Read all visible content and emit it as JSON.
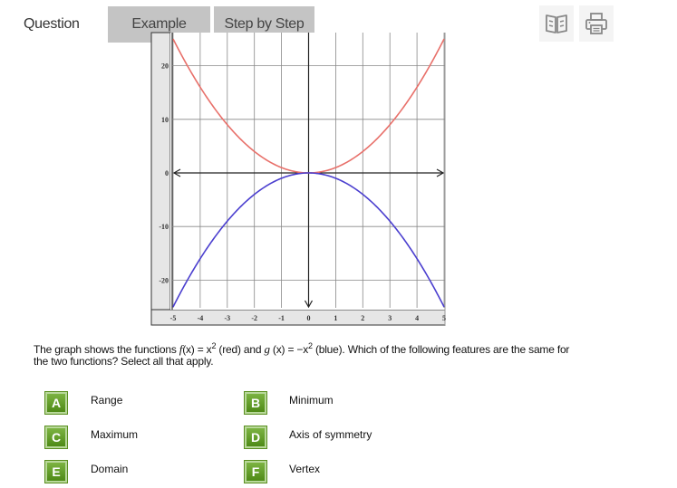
{
  "header": {
    "question_label": "Question",
    "example_label": "Example",
    "step_by_step_label": "Step by Step",
    "icons": [
      "book-icon",
      "print-icon"
    ]
  },
  "chart_data": {
    "type": "line",
    "title": "",
    "xlabel": "",
    "ylabel": "",
    "xlim": [
      -5,
      5
    ],
    "ylim": [
      -25,
      25
    ],
    "x_ticks": [
      -5,
      -4,
      -3,
      -2,
      -1,
      0,
      1,
      2,
      3,
      4,
      5
    ],
    "y_ticks": [
      20,
      10,
      0,
      -10,
      -20
    ],
    "y_tick_labels": [
      "20",
      "10",
      "0",
      "-10",
      "-20"
    ],
    "x_tick_labels": [
      "-5",
      "-4",
      "-3",
      "-2",
      "-1",
      "0",
      "1",
      "2",
      "3",
      "4",
      "5"
    ],
    "grid": true,
    "series": [
      {
        "name": "f(x) = x^2",
        "color": "#e8706a",
        "expression": "x^2",
        "x": [
          -5,
          -4,
          -3,
          -2,
          -1,
          0,
          1,
          2,
          3,
          4,
          5
        ],
        "y": [
          25,
          16,
          9,
          4,
          1,
          0,
          1,
          4,
          9,
          16,
          25
        ]
      },
      {
        "name": "g(x) = -x^2",
        "color": "#4b3fcf",
        "expression": "-x^2",
        "x": [
          -5,
          -4,
          -3,
          -2,
          -1,
          0,
          1,
          2,
          3,
          4,
          5
        ],
        "y": [
          -25,
          -16,
          -9,
          -4,
          -1,
          0,
          -1,
          -4,
          -9,
          -16,
          -25
        ]
      }
    ]
  },
  "question": {
    "prefix": "The graph shows the functions ",
    "f_lhs": "f",
    "f_arg": "(x)",
    "f_eq": " = x",
    "f_exp": "2",
    "mid": " (red) and ",
    "g_lhs": "g",
    "g_arg": " (x)",
    "g_eq": " = −x",
    "g_exp": "2",
    "suffix": " (blue). Which of the following features are the same for the two functions? Select all that apply."
  },
  "options": [
    {
      "letter": "A",
      "label": "Range"
    },
    {
      "letter": "B",
      "label": "Minimum"
    },
    {
      "letter": "C",
      "label": "Maximum"
    },
    {
      "letter": "D",
      "label": "Axis of symmetry"
    },
    {
      "letter": "E",
      "label": "Domain"
    },
    {
      "letter": "F",
      "label": "Vertex"
    }
  ],
  "colors": {
    "badge_green": "#5f9b1f",
    "tab_gray": "#c4c4c4",
    "red_curve": "#e8706a",
    "blue_curve": "#4b3fcf"
  }
}
